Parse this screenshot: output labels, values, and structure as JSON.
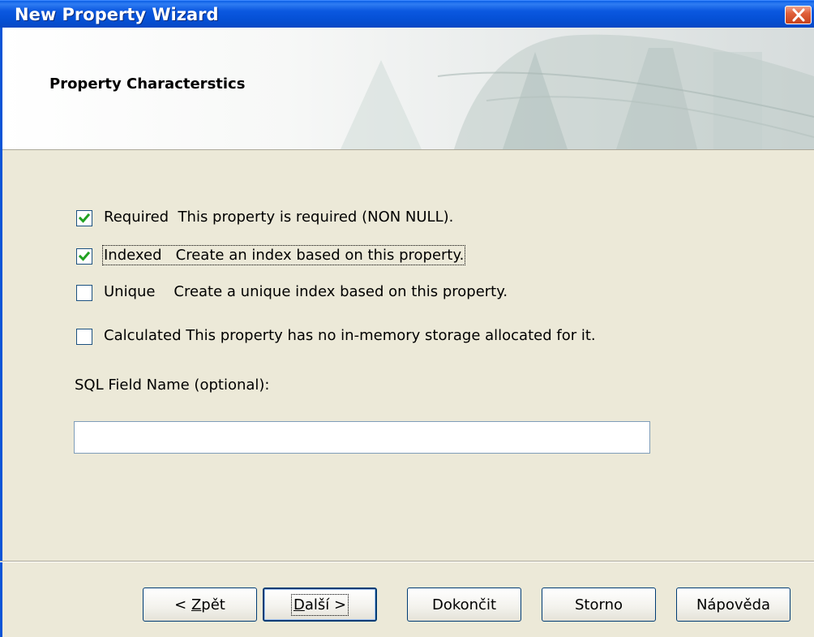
{
  "window": {
    "title": "New Property Wizard"
  },
  "header": {
    "title": "Property Characterstics"
  },
  "options": [
    {
      "name": "Required",
      "description": "This property is required (NON NULL).",
      "checked": true
    },
    {
      "name": "Indexed",
      "description": "Create an index based on this property.",
      "checked": true
    },
    {
      "name": "Unique",
      "description": "Create a unique index based on this property.",
      "checked": false
    },
    {
      "name": "Calculated",
      "description": "This property has no in-memory storage allocated for it.",
      "checked": false
    }
  ],
  "labels": {
    "opt0": "Required  This property is required (NON NULL).",
    "opt1": "Indexed   Create an index based on this property.",
    "opt2": "Unique    Create a unique index based on this property.",
    "opt3": "Calculated This property has no in-memory storage allocated for it."
  },
  "sql_field": {
    "label": "SQL Field Name (optional):",
    "value": ""
  },
  "buttons": {
    "back_prefix": "< ",
    "back_mnemonic": "Z",
    "back_rest": "pět",
    "next_mnemonic": "D",
    "next_rest": "alší >",
    "finish": "Dokončit",
    "cancel": "Storno",
    "help": "Nápověda"
  },
  "colors": {
    "titlebar": "#0550d5",
    "dialog_bg": "#ece9d8",
    "close_button": "#d9572f"
  },
  "icons": {
    "close": "close-icon",
    "check": "checkmark-icon"
  }
}
